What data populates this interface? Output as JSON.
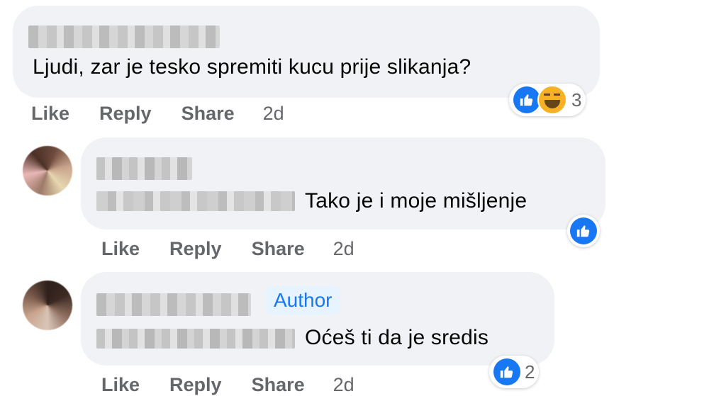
{
  "comments": [
    {
      "text": "Ljudi, zar je tesko spremiti kucu prije slikanja?",
      "actions": {
        "like": "Like",
        "reply": "Reply",
        "share": "Share",
        "time": "2d"
      },
      "reactions": {
        "icons": [
          "like-icon",
          "haha-icon"
        ],
        "count": "3"
      }
    },
    {
      "text": "Tako je i moje mišljenje",
      "actions": {
        "like": "Like",
        "reply": "Reply",
        "share": "Share",
        "time": "2d"
      },
      "reactions": {
        "icons": [
          "like-icon"
        ],
        "count": ""
      }
    },
    {
      "badge": "Author",
      "text": "Oćeš ti da je sredis",
      "actions": {
        "like": "Like",
        "reply": "Reply",
        "share": "Share",
        "time": "2d"
      },
      "reactions": {
        "icons": [
          "like-icon"
        ],
        "count": "2"
      }
    }
  ],
  "colors": {
    "bubble": "#f0f2f5",
    "action": "#65676b",
    "like": "#1877f2",
    "author_bg": "#e7f3ff"
  }
}
